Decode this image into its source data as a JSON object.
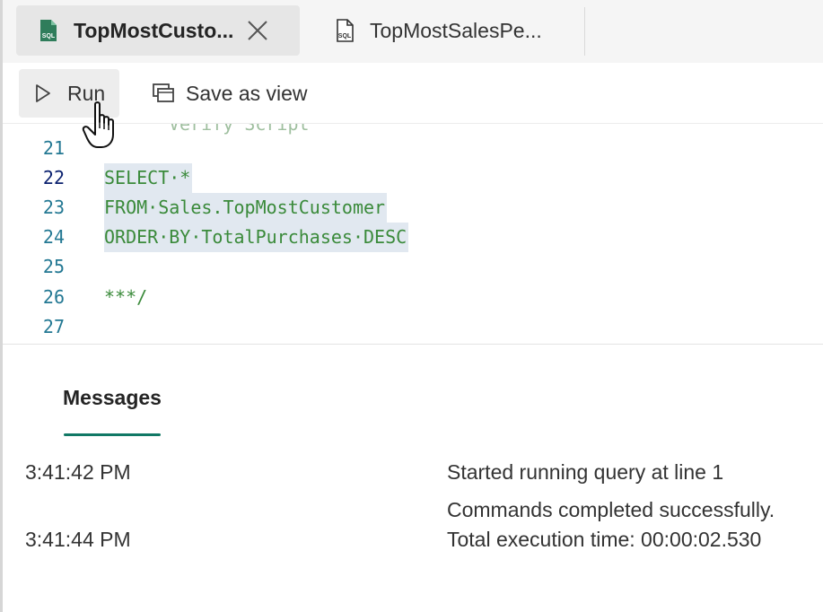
{
  "tabs": [
    {
      "label": "TopMostCusto...",
      "active": true,
      "icon": "sql-file-icon"
    },
    {
      "label": "TopMostSalesPe...",
      "active": false,
      "icon": "sql-file-outline-icon"
    }
  ],
  "icon_badge": "SQL",
  "toolbar": {
    "run_label": "Run",
    "save_view_label": "Save as view"
  },
  "editor": {
    "ghost_line_text": "Verify Script",
    "lines": [
      {
        "num": "21",
        "text": "",
        "selected": false
      },
      {
        "num": "22",
        "text": "SELECT·*",
        "selected": true
      },
      {
        "num": "23",
        "text": "FROM·Sales.TopMostCustomer",
        "selected": true
      },
      {
        "num": "24",
        "text": "ORDER·BY·TotalPurchases·DESC",
        "selected": true
      },
      {
        "num": "25",
        "text": "",
        "selected": false
      },
      {
        "num": "26",
        "text": "***/",
        "selected": false
      },
      {
        "num": "27",
        "text": "",
        "selected": false
      }
    ]
  },
  "messages": {
    "tab_label": "Messages",
    "rows": [
      {
        "time": "3:41:42 PM",
        "text": "Started running query at line 1"
      },
      {
        "time": "",
        "text": "Commands completed successfully."
      },
      {
        "time": "3:41:44 PM",
        "text": "Total execution time: 00:00:02.530"
      }
    ]
  },
  "colors": {
    "accent": "#117865",
    "code_green": "#3a8a3a",
    "line_number": "#237893",
    "selection": "#e1e8f0"
  }
}
